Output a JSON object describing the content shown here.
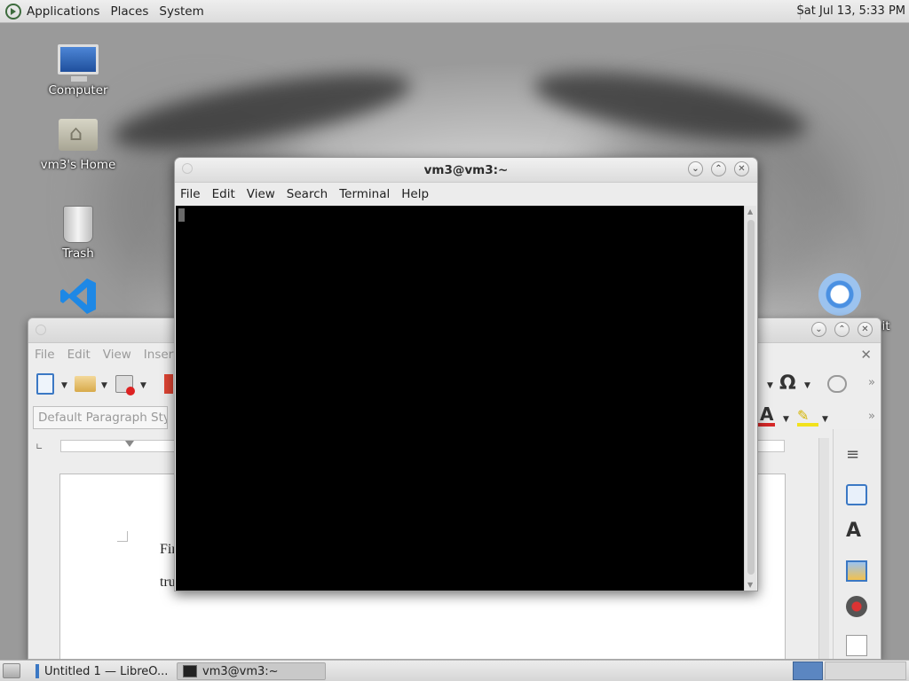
{
  "top_panel": {
    "menus": [
      "Applications",
      "Places",
      "System"
    ],
    "clock": "Sat Jul 13,  5:33 PM"
  },
  "desktop_icons": {
    "computer": "Computer",
    "home": "vm3's Home",
    "trash": "Trash",
    "partial_right": "hit"
  },
  "terminal": {
    "title": "vm3@vm3:~",
    "menu": [
      "File",
      "Edit",
      "View",
      "Search",
      "Terminal",
      "Help"
    ]
  },
  "writer": {
    "menu": [
      "File",
      "Edit",
      "View",
      "Insert"
    ],
    "paragraph_style": "Default Paragraph Style",
    "doc_lines": [
      "Firefox",
      "true"
    ]
  },
  "taskbar": {
    "items": [
      "Untitled 1 — LibreO...",
      "vm3@vm3:~"
    ]
  },
  "colors": {
    "terminal_bg": "#000000",
    "workspace_active": "#5b86c1"
  }
}
